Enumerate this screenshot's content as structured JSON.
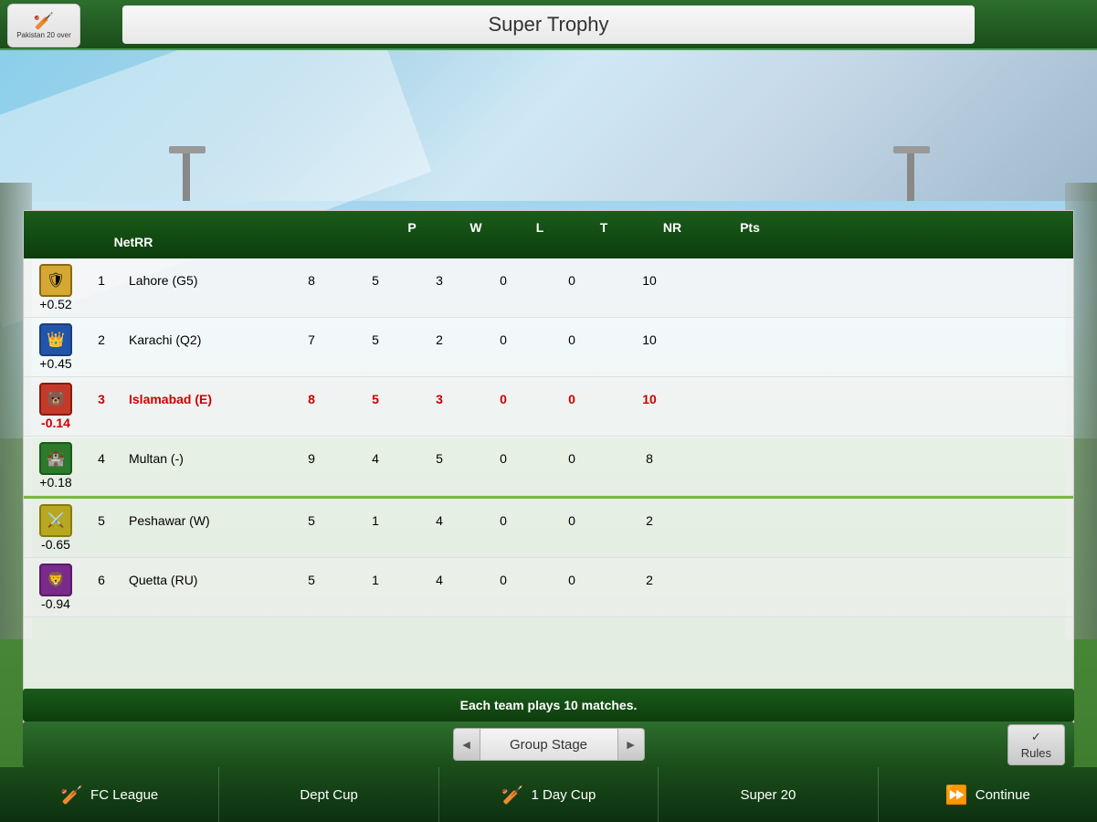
{
  "header": {
    "title": "Super Trophy",
    "logo_line1": "Pakistan 20 over",
    "tournament_icon": "🏏"
  },
  "table": {
    "columns": [
      "P",
      "W",
      "L",
      "T",
      "NR",
      "Pts",
      "NetRR"
    ],
    "rows": [
      {
        "rank": "1",
        "badge": "🛡️",
        "team": "Lahore (G5)",
        "P": "8",
        "W": "5",
        "L": "3",
        "T": "0",
        "NR": "0",
        "Pts": "10",
        "NetRR": "+0.52",
        "highlight": false,
        "badge_color": "#8B6914"
      },
      {
        "rank": "2",
        "badge": "👑",
        "team": "Karachi (Q2)",
        "P": "7",
        "W": "5",
        "L": "2",
        "T": "0",
        "NR": "0",
        "Pts": "10",
        "NetRR": "+0.45",
        "highlight": false,
        "badge_color": "#1a4d8a"
      },
      {
        "rank": "3",
        "badge": "🐻",
        "team": "Islamabad (E)",
        "P": "8",
        "W": "5",
        "L": "3",
        "T": "0",
        "NR": "0",
        "Pts": "10",
        "NetRR": "-0.14",
        "highlight": true,
        "badge_color": "#8a1a1a"
      },
      {
        "rank": "4",
        "badge": "🏰",
        "team": "Multan (-)",
        "P": "9",
        "W": "4",
        "L": "5",
        "T": "0",
        "NR": "0",
        "Pts": "8",
        "NetRR": "+0.18",
        "highlight": false,
        "badge_color": "#2d6e2d",
        "separator_after": true
      },
      {
        "rank": "5",
        "badge": "⚔️",
        "team": "Peshawar (W)",
        "P": "5",
        "W": "1",
        "L": "4",
        "T": "0",
        "NR": "0",
        "Pts": "2",
        "NetRR": "-0.65",
        "highlight": false,
        "badge_color": "#8a8a1a"
      },
      {
        "rank": "6",
        "badge": "🦁",
        "team": "Quetta (RU)",
        "P": "5",
        "W": "1",
        "L": "4",
        "T": "0",
        "NR": "0",
        "Pts": "2",
        "NetRR": "-0.94",
        "highlight": false,
        "badge_color": "#6a1a6a"
      }
    ]
  },
  "stage": {
    "label": "Group Stage",
    "prev_arrow": "◄",
    "next_arrow": "►",
    "rules_label": "Rules",
    "rules_check": "✓"
  },
  "info_bar": {
    "text": "Each team plays 10 matches."
  },
  "bottom_nav": {
    "items": [
      {
        "icon": "🏏",
        "label": "FC League"
      },
      {
        "icon": "",
        "label": "Dept Cup"
      },
      {
        "icon": "🏏",
        "label": "1 Day Cup"
      },
      {
        "icon": "",
        "label": "Super 20"
      },
      {
        "icon": "⏩",
        "label": "Continue"
      }
    ]
  }
}
